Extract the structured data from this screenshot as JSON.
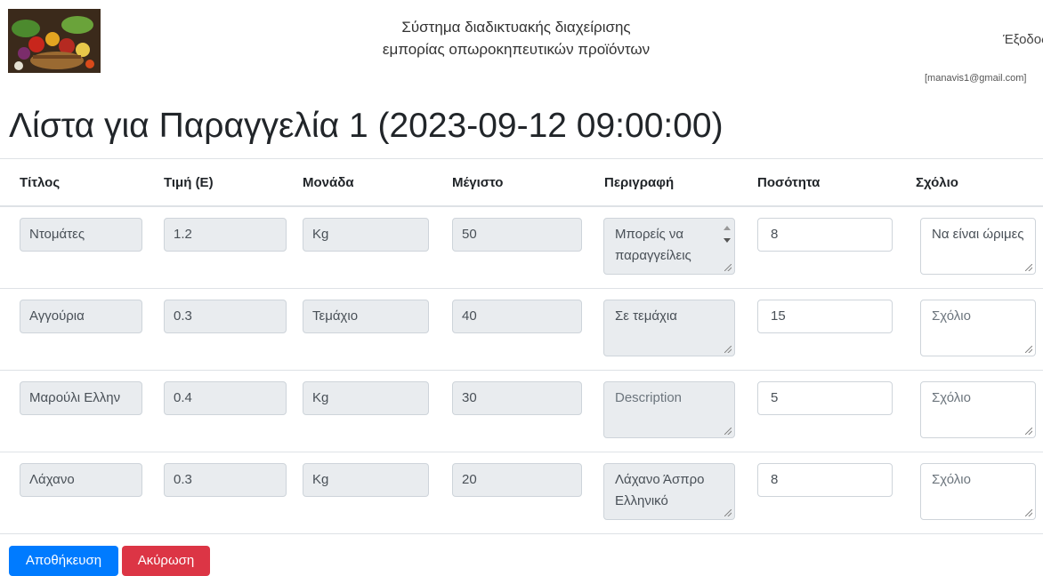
{
  "header": {
    "site_title_line1": "Σύστημα διαδικτυακής διαχείρισης",
    "site_title_line2": "εμπορίας οπωροκηπευτικών προϊόντων",
    "logout_label": "Έξοδος",
    "user_email": "[manavis1@gmail.com]"
  },
  "page_title": "Λίστα για Παραγγελία 1 (2023-09-12 09:00:00)",
  "table": {
    "headers": [
      "Τίτλος",
      "Τιμή (Ε)",
      "Μονάδα",
      "Μέγιστο",
      "Περιγραφή",
      "Ποσότητα",
      "Σχόλιο"
    ],
    "rows": [
      {
        "title": "Ντομάτες",
        "price": "1.2",
        "unit": "Kg",
        "max": "50",
        "description": "Μπορείς να παραγγείλεις",
        "quantity": "8",
        "comment": "Να είναι ώριμες",
        "comment_placeholder": "Σχόλιο"
      },
      {
        "title": "Αγγούρια",
        "price": "0.3",
        "unit": "Τεμάχιο",
        "max": "40",
        "description": "Σε τεμάχια",
        "quantity": "15",
        "comment": "",
        "comment_placeholder": "Σχόλιο"
      },
      {
        "title": "Μαρούλι Ελλην",
        "price": "0.4",
        "unit": "Kg",
        "max": "30",
        "description": "Description",
        "quantity": "5",
        "comment": "",
        "comment_placeholder": "Σχόλιο"
      },
      {
        "title": "Λάχανο",
        "price": "0.3",
        "unit": "Kg",
        "max": "20",
        "description": "Λάχανο Άσπρο Ελληνικό",
        "quantity": "8",
        "comment": "",
        "comment_placeholder": "Σχόλιο"
      }
    ]
  },
  "actions": {
    "save_label": "Αποθήκευση",
    "cancel_label": "Ακύρωση"
  },
  "colors": {
    "primary": "#007bff",
    "danger": "#dc3545",
    "readonly_bg": "#e9ecef"
  }
}
